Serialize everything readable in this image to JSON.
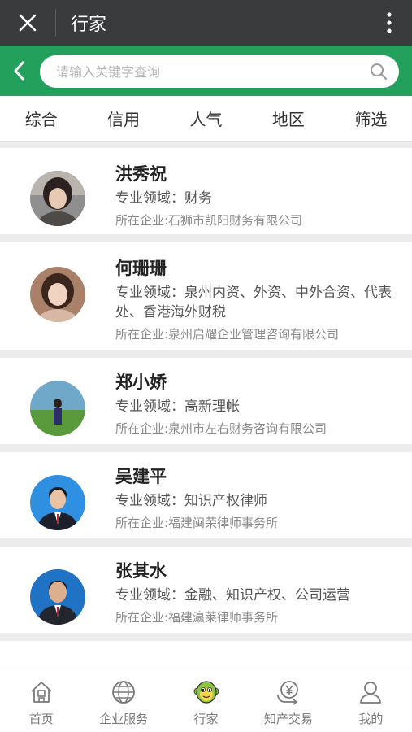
{
  "window": {
    "title": "行家"
  },
  "search": {
    "placeholder": "请输入关键字查询"
  },
  "filters": [
    "综合",
    "信用",
    "人气",
    "地区",
    "筛选"
  ],
  "experts": [
    {
      "name": "洪秀祝",
      "field": "专业领域：财务",
      "company": "所在企业:石狮市凯阳财务有限公司"
    },
    {
      "name": "何珊珊",
      "field": "专业领域：泉州内资、外资、中外合资、代表处、香港海外财税",
      "company": "所在企业:泉州启耀企业管理咨询有限公司"
    },
    {
      "name": "郑小娇",
      "field": "专业领域：高新理帐",
      "company": "所在企业:泉州市左右财务咨询有限公司"
    },
    {
      "name": "吴建平",
      "field": "专业领域：知识产权律师",
      "company": "所在企业:福建闽荣律师事务所"
    },
    {
      "name": "张其水",
      "field": "专业领域：金融、知识产权、公司运营",
      "company": "所在企业:福建瀛莱律师事务所"
    }
  ],
  "bottom_nav": [
    {
      "label": "首页",
      "icon": "home-icon"
    },
    {
      "label": "企业服务",
      "icon": "globe-icon"
    },
    {
      "label": "行家",
      "icon": "monkey-mascot-icon"
    },
    {
      "label": "知产交易",
      "icon": "yuan-exchange-icon"
    },
    {
      "label": "我的",
      "icon": "user-icon"
    }
  ],
  "colors": {
    "topbar": "#3a3b3c",
    "accent_green": "#23a15c"
  }
}
